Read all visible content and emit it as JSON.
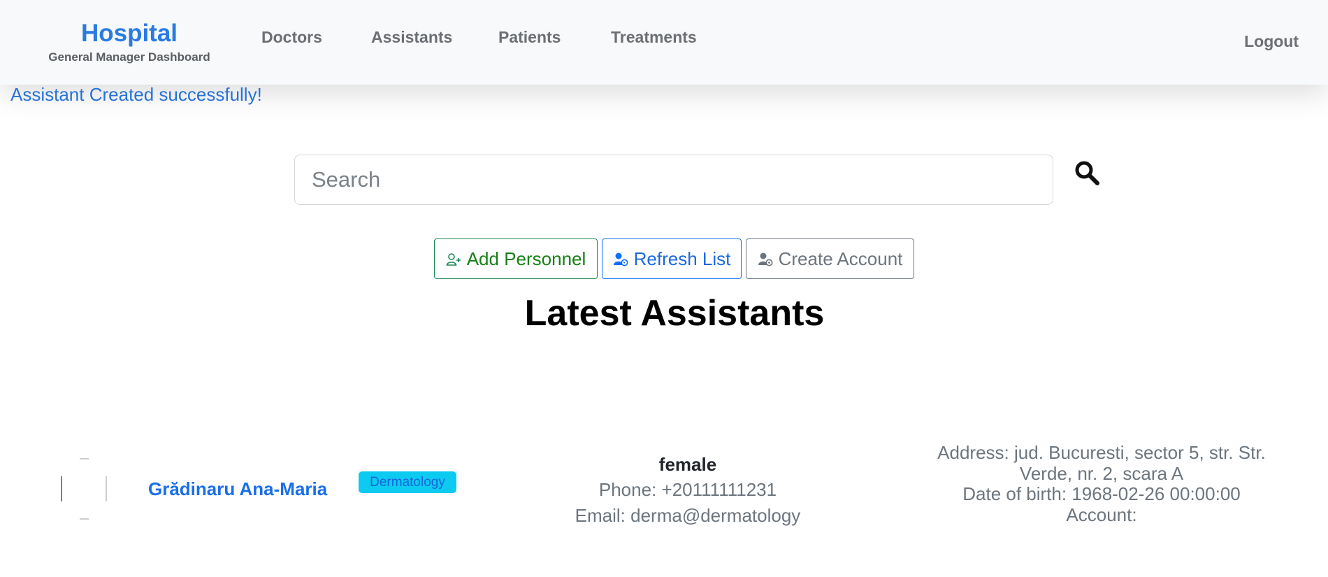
{
  "brand": {
    "title": "Hospital",
    "subtitle": "General Manager Dashboard"
  },
  "nav": {
    "items": [
      "Doctors",
      "Assistants",
      "Patients",
      "Treatments"
    ],
    "logout": "Logout"
  },
  "flash": "Assistant Created successfully!",
  "search": {
    "placeholder": "Search",
    "value": "",
    "icon": "search-icon"
  },
  "actions": {
    "add": {
      "label": "Add Personnel",
      "icon": "add-person-icon",
      "color": "#198754"
    },
    "refresh": {
      "label": "Refresh List",
      "icon": "user-refresh-icon",
      "color": "#0d6efd"
    },
    "create": {
      "label": "Create Account",
      "icon": "user-settings-icon",
      "color": "#6c757d"
    }
  },
  "section_title": "Latest Assistants",
  "assistants": [
    {
      "name": "Grădinaru Ana-Maria",
      "department": "Dermatology",
      "gender": "female",
      "phone": "Phone: +20111111231",
      "email": "Email: derma@dermatology",
      "address": "Address: jud. Bucuresti, sector 5, str. Str. Verde, nr. 2, scara A",
      "dob": "Date of birth: 1968-02-26 00:00:00",
      "account": "Account:"
    }
  ]
}
